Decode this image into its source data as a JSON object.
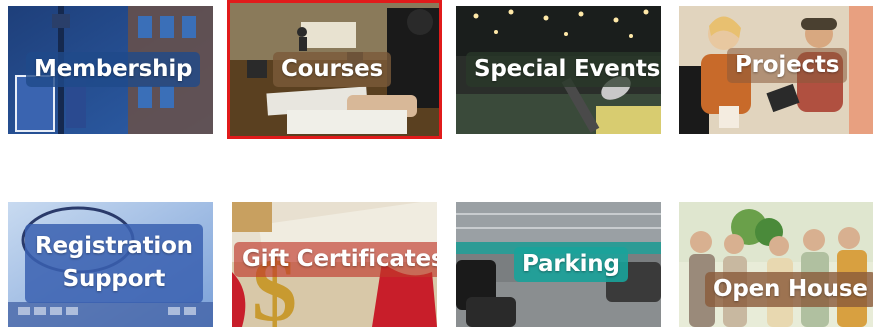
{
  "tiles": [
    {
      "id": "membership",
      "label": "Membership",
      "selected": false,
      "label_bg": "#1f4a8a"
    },
    {
      "id": "courses",
      "label": "Courses",
      "selected": true,
      "label_bg": "#7a5a3a"
    },
    {
      "id": "special-events",
      "label": "Special Events",
      "selected": false,
      "label_bg": "#2a3a2a"
    },
    {
      "id": "projects",
      "label": "Projects",
      "selected": false,
      "label_bg": "#8a5a3a"
    },
    {
      "id": "registration-support",
      "label_line1": "Registration",
      "label_line2": "Support",
      "selected": false,
      "label_bg": "#3a60b0"
    },
    {
      "id": "gift-certificates",
      "label": "Gift Certificates",
      "selected": false,
      "label_bg": "#c0392b"
    },
    {
      "id": "parking",
      "label": "Parking",
      "selected": false,
      "label_bg": "#1aa39a"
    },
    {
      "id": "open-house",
      "label": "Open House",
      "selected": false,
      "label_bg": "#8a5a3a"
    }
  ],
  "colors": {
    "selection_border": "#e11b1b"
  }
}
